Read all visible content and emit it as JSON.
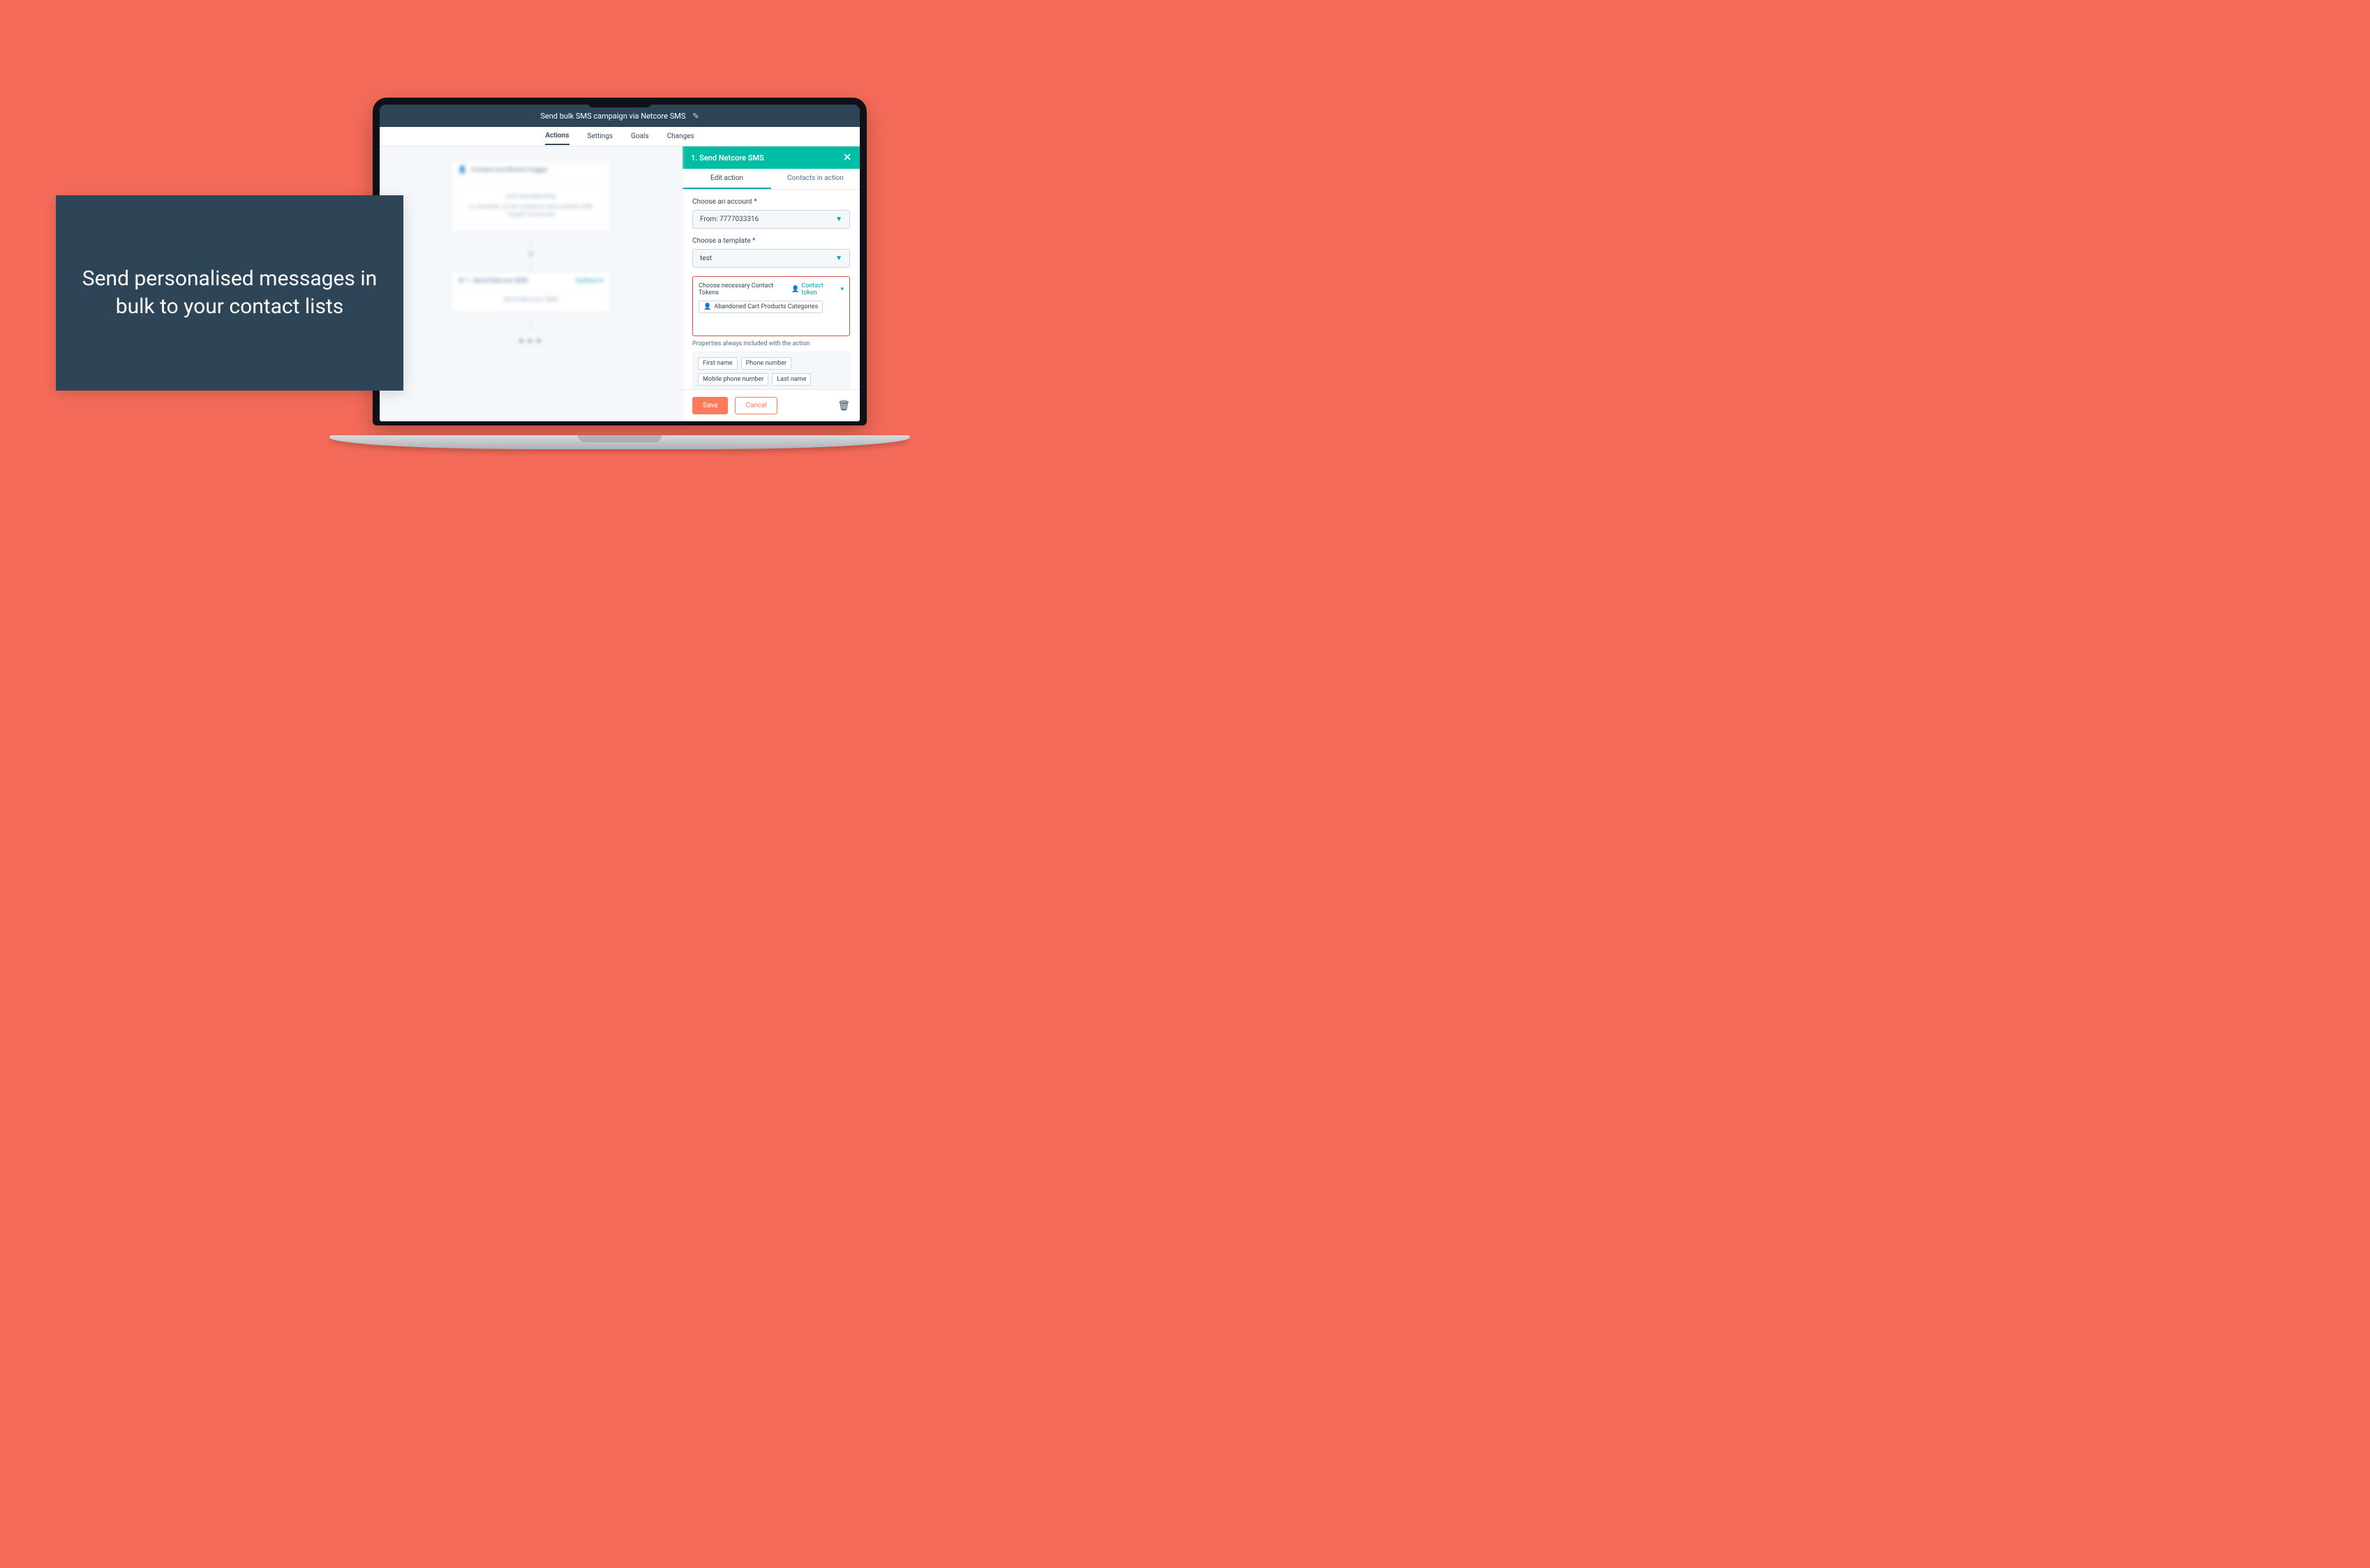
{
  "banner_text": "Send personalised messages in bulk to your contact lists",
  "app": {
    "title": "Send bulk SMS campaign via Netcore SMS",
    "tabs": {
      "actions": "Actions",
      "settings": "Settings",
      "goals": "Goals",
      "changes": "Changes"
    }
  },
  "workflow": {
    "trigger_head": "Contact enrollment trigger",
    "trigger_title": "List membership",
    "trigger_line": "is member of All contacts associated with Target Accounts",
    "action_head": "1. Send Netcore SMS",
    "action_menu": "Actions",
    "action_body": "Send Netcore SMS"
  },
  "panel": {
    "title": "1. Send Netcore SMS",
    "tabs": {
      "edit": "Edit action",
      "contacts": "Contacts in action"
    },
    "account_label": "Choose an account *",
    "account_value": "From: 7777033316",
    "template_label": "Choose a template *",
    "template_value": "test",
    "token_label": "Choose necessary Contact Tokens",
    "token_link": "Contact token",
    "token_chip": "Abandoned Cart Products Categories",
    "props_label": "Properties always included with the action",
    "props": {
      "first": "First name",
      "phone": "Phone number",
      "mobile": "Mobile phone number",
      "last": "Last name"
    },
    "save": "Save",
    "cancel": "Cancel"
  }
}
